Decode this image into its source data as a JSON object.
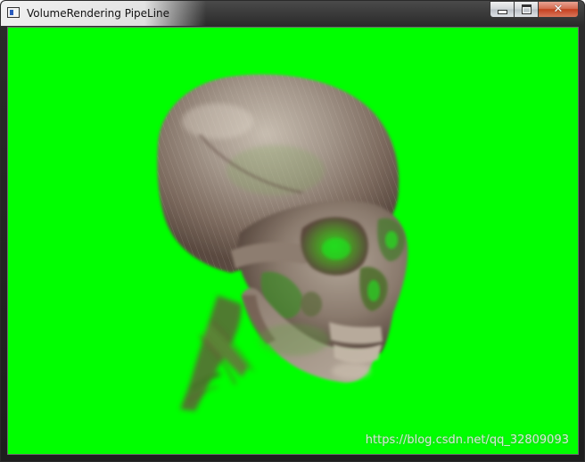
{
  "window": {
    "title": "VolumeRendering PipeLine",
    "icon": "application-icon"
  },
  "caption_buttons": {
    "minimize": "minimize-icon",
    "maximize": "maximize-icon",
    "close_glyph": "✕"
  },
  "render_view": {
    "background_color": "#00ff00",
    "subject": "volume-rendered skull",
    "subject_colors": {
      "bone": "#9a8a7e",
      "bone_dark": "#5e4a40",
      "bone_highlight": "#c9bcad"
    }
  },
  "watermark": {
    "text": "https://blog.csdn.net/qq_32809093"
  }
}
